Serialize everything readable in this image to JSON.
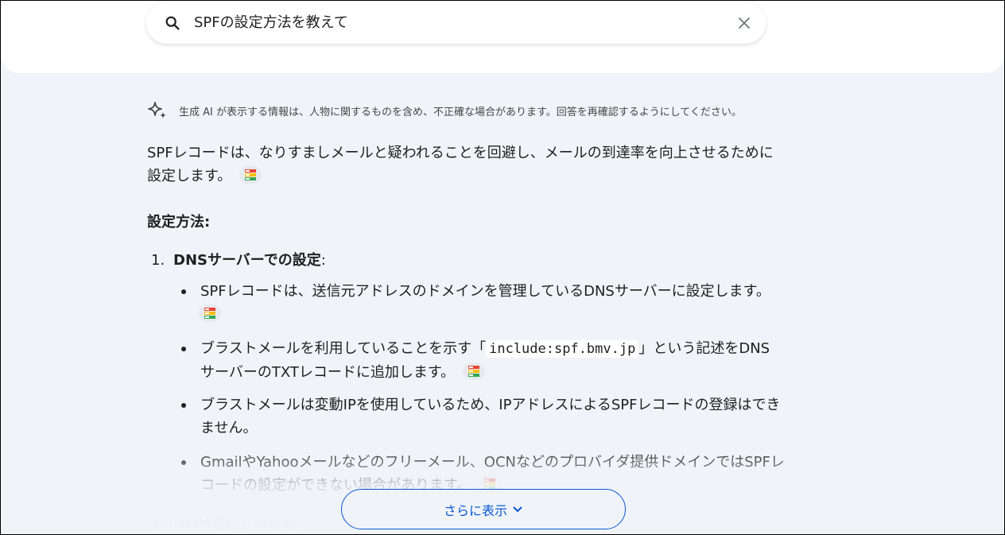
{
  "search": {
    "query": "SPFの設定方法を教えて"
  },
  "disclaimer": {
    "text": "生成 AI が表示する情報は、人物に関するものを含め、不正確な場合があります。回答を再確認するようにしてください。"
  },
  "answer": {
    "intro_line1": "SPFレコードは、なりすましメールと疑われることを回避し、メールの到達率を向上させるために",
    "intro_line2": "設定します。",
    "heading": "設定方法:",
    "steps": [
      {
        "number": "1.",
        "title": "DNSサーバーでの設定",
        "suffix": ":"
      },
      {
        "number": "2.",
        "title": "DKIM署名との併用",
        "suffix": ":"
      }
    ],
    "bullets": [
      {
        "text": "SPFレコードは、送信元アドレスのドメインを管理しているDNSサーバーに設定します。"
      },
      {
        "text_before": "ブラストメールを利用していることを示す「",
        "code": "include:spf.bmv.jp",
        "text_after_line1": "」という記述をDNS",
        "text_line2": "サーバーのTXTレコードに追加します。"
      },
      {
        "text_line1": "ブラストメールは変動IPを使用しているため、IPアドレスによるSPFレコードの登録はでき",
        "text_line2": "ません。"
      },
      {
        "text_line1": "GmailやYahooメールなどのフリーメール、OCNなどのプロバイダ提供ドメインではSPFレ",
        "text_line2": "コードの設定ができない場合があります。"
      }
    ]
  },
  "show_more": {
    "label": "さらに表示"
  },
  "colors": {
    "accent": "#0b57d0",
    "background": "#f0f4f9",
    "text": "#1f1f1f"
  }
}
